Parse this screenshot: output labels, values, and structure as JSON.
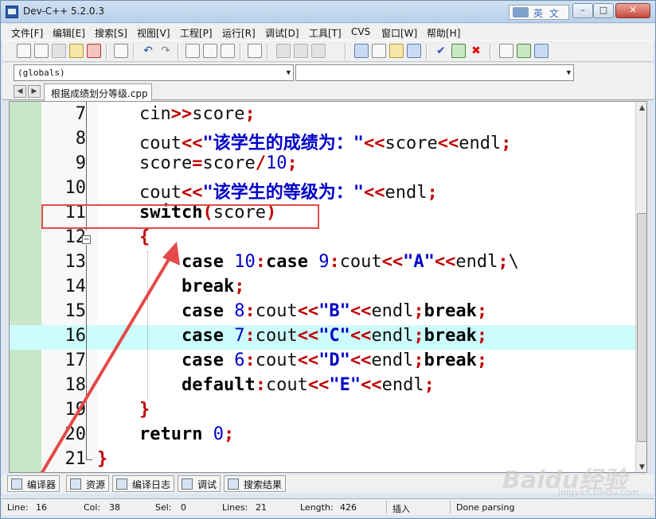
{
  "window": {
    "title": "Dev-C++ 5.2.0.3",
    "ime_label": "英 文"
  },
  "menu": [
    "文件[F]",
    "编辑[E]",
    "搜索[S]",
    "视图[V]",
    "工程[P]",
    "运行[R]",
    "调试[D]",
    "工具[T]",
    "CVS",
    "窗口[W]",
    "帮助[H]"
  ],
  "selectors": {
    "scope": "(globals)",
    "member": ""
  },
  "tab": {
    "filename": "根据成绩划分等级.cpp"
  },
  "editor": {
    "highlight_line": 16,
    "lines": [
      {
        "n": "7"
      },
      {
        "n": "8"
      },
      {
        "n": "9"
      },
      {
        "n": "10"
      },
      {
        "n": "11"
      },
      {
        "n": "12"
      },
      {
        "n": "13"
      },
      {
        "n": "14"
      },
      {
        "n": "15"
      },
      {
        "n": "16"
      },
      {
        "n": "17"
      },
      {
        "n": "18"
      },
      {
        "n": "19"
      },
      {
        "n": "20"
      },
      {
        "n": "21"
      }
    ],
    "str_score_is": "\"该学生的成绩为：\"",
    "str_grade_is": "\"该学生的等级为：\"",
    "str_a": "\"A\"",
    "str_b": "\"B\"",
    "str_c": "\"C\"",
    "str_d": "\"D\"",
    "str_e": "\"E\""
  },
  "bottom_tabs": [
    "编译器",
    "资源",
    "编译日志",
    "调试",
    "搜索结果"
  ],
  "status": {
    "line_label": "Line:",
    "line_value": "16",
    "col_label": "Col:",
    "col_value": "38",
    "sel_label": "Sel:",
    "sel_value": "0",
    "lines_label": "Lines:",
    "lines_value": "21",
    "length_label": "Length:",
    "length_value": "426",
    "mode": "插入",
    "message": "Done parsing"
  },
  "watermark": {
    "brand": "Baidu经验",
    "url": "jingyan.baidu.com"
  },
  "colors": {
    "highlight": "#ccfcfc",
    "gutter": "#c8e6c8",
    "annotation": "#e34a48"
  }
}
